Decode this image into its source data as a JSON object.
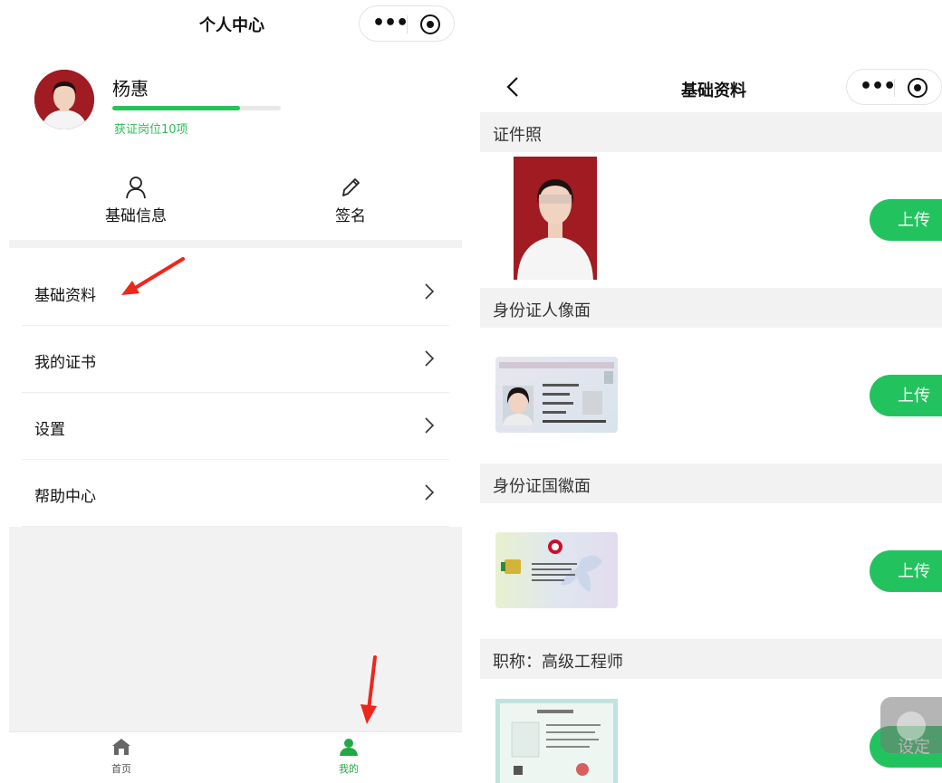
{
  "left": {
    "title": "个人中心",
    "user": {
      "name": "杨惠",
      "cert_text": "获证岗位10项",
      "progress": 0.76
    },
    "quick_actions": [
      {
        "label": "基础信息",
        "icon": "user-icon"
      },
      {
        "label": "签名",
        "icon": "pencil-icon"
      }
    ],
    "menu": [
      {
        "label": "基础资料"
      },
      {
        "label": "我的证书"
      },
      {
        "label": "设置"
      },
      {
        "label": "帮助中心"
      }
    ],
    "tabs": [
      {
        "label": "首页",
        "icon": "home-icon"
      },
      {
        "label": "我的",
        "icon": "person-icon",
        "active": true
      }
    ]
  },
  "right": {
    "title": "基础资料",
    "sections": [
      {
        "label": "证件照",
        "button": "上传"
      },
      {
        "label": "身份证人像面",
        "button": "上传"
      },
      {
        "label": "身份证国徽面",
        "button": "上传"
      },
      {
        "label": "职称：高级工程师",
        "button": "设定"
      }
    ]
  },
  "colors": {
    "accent": "#22c35e",
    "arrow": "#f0251c",
    "photo_bg": "#a01b22"
  }
}
